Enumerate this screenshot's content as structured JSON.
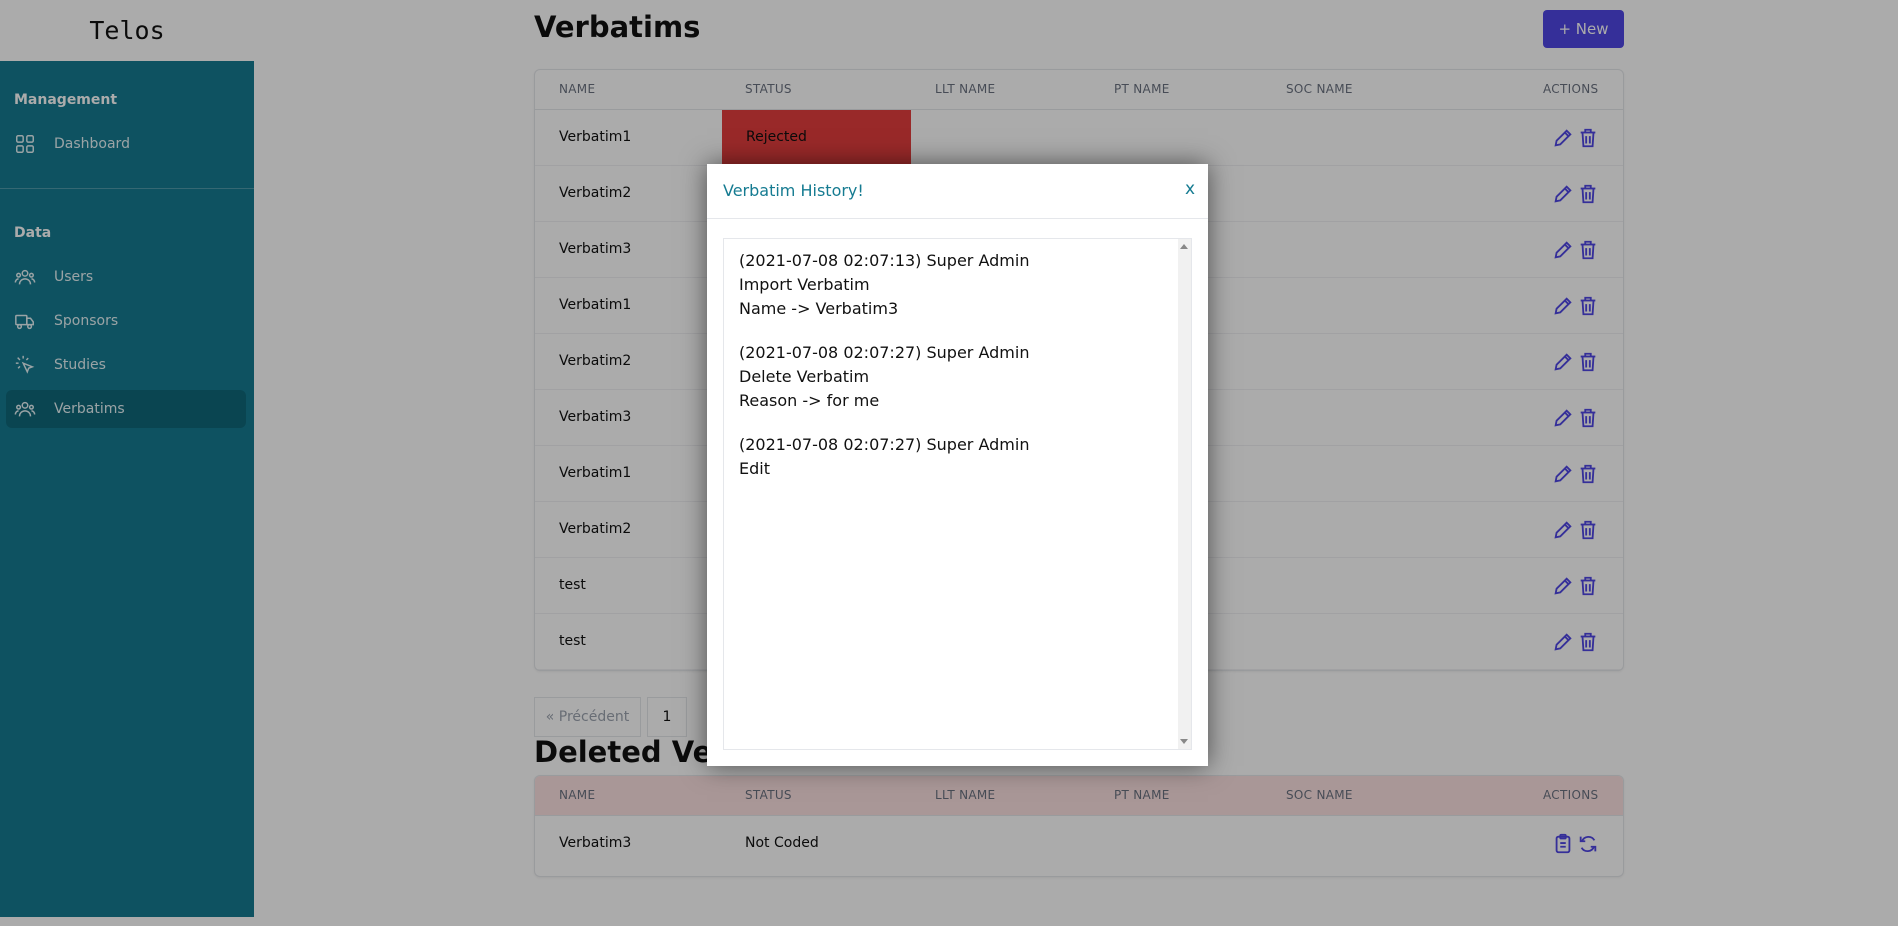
{
  "brand": "Telos",
  "sidebar": {
    "sections": [
      {
        "title": "Management",
        "items": [
          {
            "label": "Dashboard",
            "icon": "grid-icon"
          }
        ]
      },
      {
        "title": "Data",
        "items": [
          {
            "label": "Users",
            "icon": "users-icon"
          },
          {
            "label": "Sponsors",
            "icon": "truck-icon"
          },
          {
            "label": "Studies",
            "icon": "cursor-click-icon"
          },
          {
            "label": "Verbatims",
            "icon": "users-icon",
            "active": true
          }
        ]
      }
    ]
  },
  "main": {
    "title": "Verbatims",
    "new_button": "+ New",
    "columns": [
      "NAME",
      "STATUS",
      "LLT NAME",
      "PT NAME",
      "SOC NAME",
      "ACTIONS"
    ],
    "rows": [
      {
        "name": "Verbatim1",
        "status": "Rejected"
      },
      {
        "name": "Verbatim2",
        "status": ""
      },
      {
        "name": "Verbatim3",
        "status": ""
      },
      {
        "name": "Verbatim1",
        "status": ""
      },
      {
        "name": "Verbatim2",
        "status": ""
      },
      {
        "name": "Verbatim3",
        "status": ""
      },
      {
        "name": "Verbatim1",
        "status": ""
      },
      {
        "name": "Verbatim2",
        "status": ""
      },
      {
        "name": "test",
        "status": ""
      },
      {
        "name": "test",
        "status": ""
      }
    ],
    "pagination": {
      "prev": "« Précédent",
      "page": "1"
    },
    "deleted_title": "Deleted Verbatims",
    "deleted_rows": [
      {
        "name": "Verbatim3",
        "status": "Not Coded"
      }
    ]
  },
  "modal": {
    "title": "Verbatim History!",
    "close": "x",
    "entries": [
      {
        "lines": [
          "(2021-07-08 02:07:13) Super Admin",
          "Import Verbatim",
          "Name -> Verbatim3"
        ]
      },
      {
        "lines": [
          "(2021-07-08 02:07:27) Super Admin",
          "Delete Verbatim",
          "Reason -> for me"
        ]
      },
      {
        "lines": [
          "(2021-07-08 02:07:27) Super Admin",
          "Edit"
        ]
      }
    ]
  },
  "colors": {
    "sidebar": "#157b91",
    "accent": "#4f46e5",
    "rejected": "#e53e3e",
    "deleted_header": "#fde2e2"
  }
}
